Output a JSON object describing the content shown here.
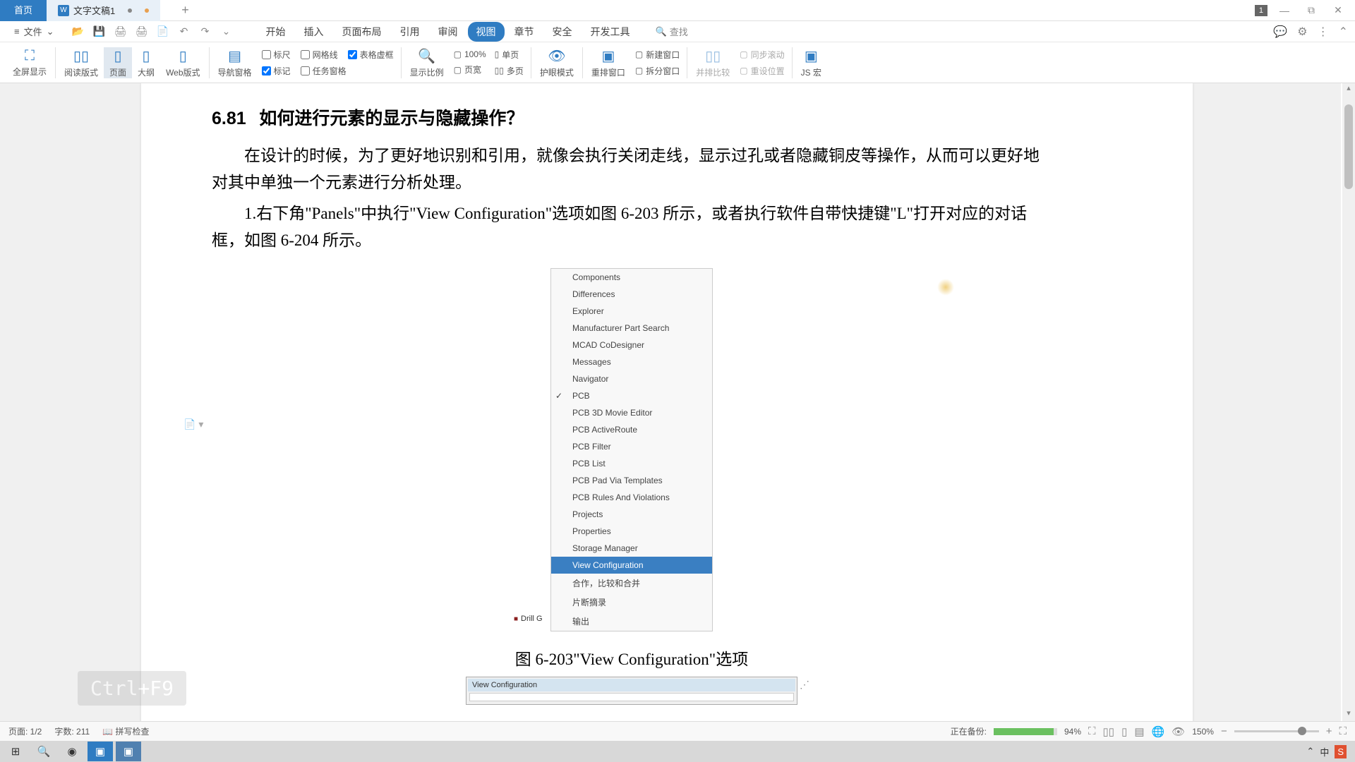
{
  "titlebar": {
    "home_tab": "首页",
    "doc_tab": "文字文稿1",
    "doc_icon": "W",
    "plus": "+",
    "badge": "1"
  },
  "menubar": {
    "file": "文件",
    "items": [
      "开始",
      "插入",
      "页面布局",
      "引用",
      "审阅",
      "视图",
      "章节",
      "安全",
      "开发工具"
    ],
    "active_index": 5,
    "search": "查找"
  },
  "ribbon": {
    "fullscreen": "全屏显示",
    "read_mode": "阅读版式",
    "page_view": "页面",
    "outline": "大纲",
    "web_view": "Web版式",
    "nav_pane": "导航窗格",
    "ruler": "标尺",
    "gridlines": "网格线",
    "table_guides": "表格虚框",
    "marks": "标记",
    "task_pane": "任务窗格",
    "zoom": "显示比例",
    "zoom_100": "100%",
    "single_page": "单页",
    "page_width": "页宽",
    "multi_page": "多页",
    "eye_mode": "护眼模式",
    "rearrange": "重排窗口",
    "new_window": "新建窗口",
    "split": "拆分窗口",
    "side_by_side": "并排比较",
    "sync_scroll": "同步滚动",
    "reset_pos": "重设位置",
    "js_macro": "JS 宏"
  },
  "document": {
    "heading_num": "6.81",
    "heading_text": "如何进行元素的显示与隐藏操作？",
    "para1": "在设计的时候，为了更好地识别和引用，就像会执行关闭走线，显示过孔或者隐藏铜皮等操作，从而可以更好地对其中单独一个元素进行分析处理。",
    "para2": "1.右下角\"Panels\"中执行\"View Configuration\"选项如图 6-203 所示，或者执行软件自带快捷键\"L\"打开对应的对话框，如图 6-204 所示。",
    "menu_items": [
      "Components",
      "Differences",
      "Explorer",
      "Manufacturer Part Search",
      "MCAD CoDesigner",
      "Messages",
      "Navigator",
      "PCB",
      "PCB 3D Movie Editor",
      "PCB ActiveRoute",
      "PCB Filter",
      "PCB List",
      "PCB Pad Via Templates",
      "PCB Rules And Violations",
      "Projects",
      "Properties",
      "Storage Manager",
      "View Configuration",
      "合作，比较和合并",
      "片断摘录",
      "输出"
    ],
    "menu_checked_index": 7,
    "menu_selected_index": 17,
    "drill_label": "Drill G",
    "caption1": "图 6-203\"View Configuration\"选项",
    "fig2_title": "View Configuration"
  },
  "kbd_hint": "Ctrl+F9",
  "statusbar": {
    "page": "页面: 1/2",
    "words": "字数: 211",
    "spell": "拼写检查",
    "backup": "正在备份:",
    "backup_pct": "94%",
    "zoom": "150%"
  },
  "taskbar": {
    "ime": "中"
  }
}
